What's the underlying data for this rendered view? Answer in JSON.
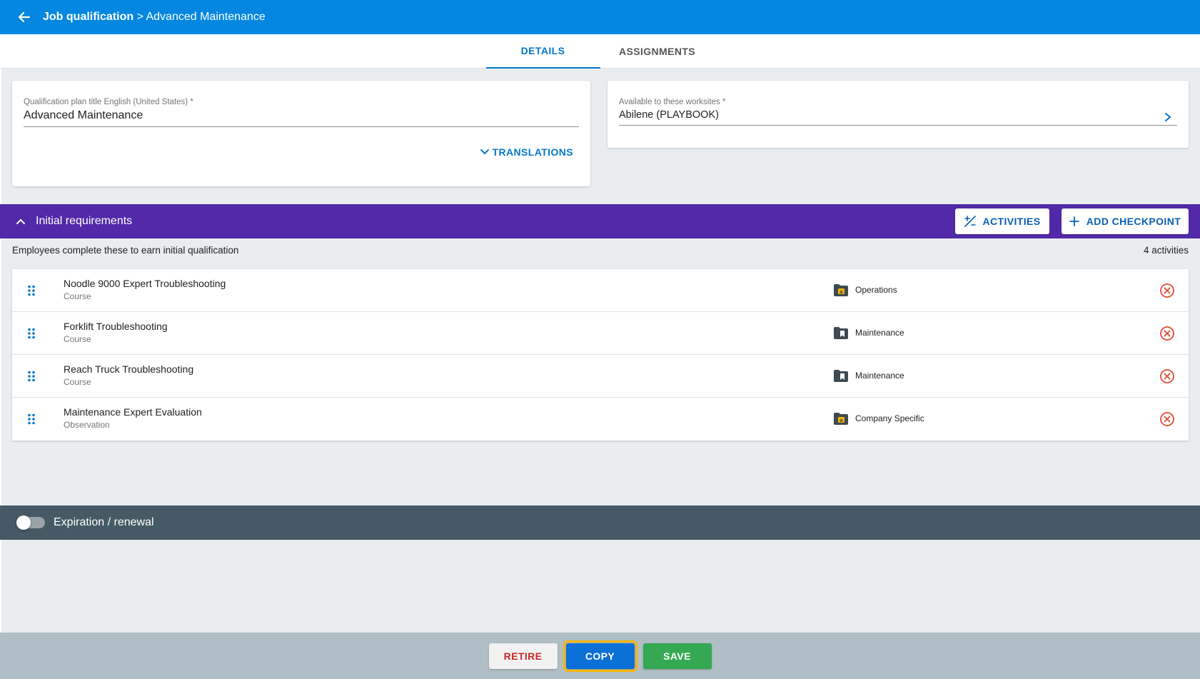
{
  "colors": {
    "header": "#0387e0",
    "accent": "#0378c9",
    "section": "#5229a8",
    "expiration_bar": "#455a64",
    "footer": "#b0bec5",
    "remove": "#e5482e",
    "copy_outline": "#f8b400"
  },
  "header": {
    "back_icon": "arrow-left-icon",
    "crumb_parent": "Job qualification",
    "crumb_sep": " > ",
    "crumb_current": "Advanced Maintenance"
  },
  "tabs": [
    {
      "label": "DETAILS",
      "active": true
    },
    {
      "label": "ASSIGNMENTS",
      "active": false
    }
  ],
  "title_card": {
    "label": "Qualification plan title English (United States) *",
    "value": "Advanced Maintenance",
    "translations_label": "TRANSLATIONS"
  },
  "worksites_card": {
    "label": "Available to these worksites *",
    "value": "Abilene (PLAYBOOK)"
  },
  "initial_requirements": {
    "title": "Initial requirements",
    "activities_button": "ACTIVITIES",
    "add_checkpoint_button": "ADD CHECKPOINT",
    "description": "Employees complete these to earn initial qualification",
    "count": "4 activities",
    "items": [
      {
        "name": "Noodle 9000 Expert Troubleshooting",
        "type": "Course",
        "category": "Operations",
        "folder_icon": "folder-company-icon"
      },
      {
        "name": "Forklift Troubleshooting",
        "type": "Course",
        "category": "Maintenance",
        "folder_icon": "folder-bookmark-icon"
      },
      {
        "name": "Reach Truck Troubleshooting",
        "type": "Course",
        "category": "Maintenance",
        "folder_icon": "folder-bookmark-icon"
      },
      {
        "name": "Maintenance Expert Evaluation",
        "type": "Observation",
        "category": "Company Specific",
        "folder_icon": "folder-company-icon"
      }
    ]
  },
  "expiration": {
    "label": "Expiration / renewal",
    "enabled": false
  },
  "footer": {
    "retire": "RETIRE",
    "copy": "COPY",
    "save": "SAVE"
  }
}
